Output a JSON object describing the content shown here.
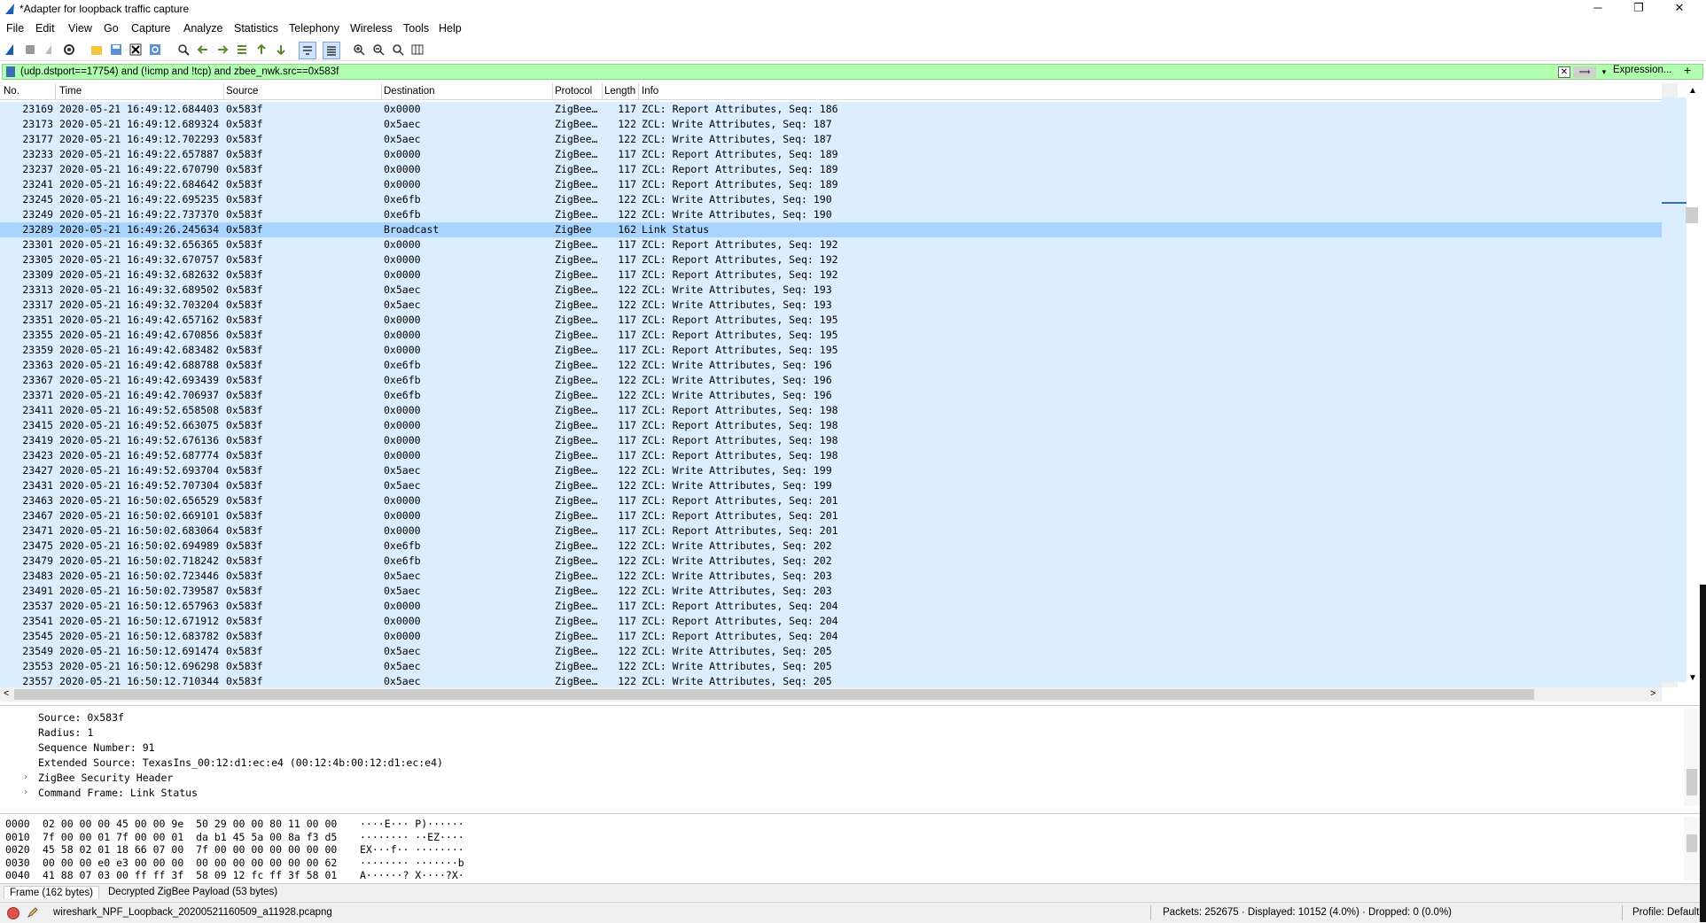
{
  "window": {
    "title": "*Adapter for loopback traffic capture",
    "minimize": "─",
    "restore": "❐",
    "close": "✕"
  },
  "menu": [
    "File",
    "Edit",
    "View",
    "Go",
    "Capture",
    "Analyze",
    "Statistics",
    "Telephony",
    "Wireless",
    "Tools",
    "Help"
  ],
  "filter": {
    "value": "(udp.dstport==17754) and (!icmp and !tcp) and zbee_nwk.src==0x583f",
    "clear": "✕",
    "apply": "⟹",
    "dropdown": "▾",
    "expression_label": "Expression...",
    "add_label": "+"
  },
  "columns": {
    "no": "No.",
    "time": "Time",
    "source": "Source",
    "destination": "Destination",
    "protocol": "Protocol",
    "length": "Length",
    "info": "Info"
  },
  "packets": [
    {
      "no": "23169",
      "time": "2020-05-21 16:49:12.684403",
      "src": "0x583f",
      "dst": "0x0000",
      "proto": "ZigBee…",
      "len": "117",
      "info": "ZCL: Report Attributes, Seq: 186",
      "selected": false
    },
    {
      "no": "23173",
      "time": "2020-05-21 16:49:12.689324",
      "src": "0x583f",
      "dst": "0x5aec",
      "proto": "ZigBee…",
      "len": "122",
      "info": "ZCL: Write Attributes, Seq: 187",
      "selected": false
    },
    {
      "no": "23177",
      "time": "2020-05-21 16:49:12.702293",
      "src": "0x583f",
      "dst": "0x5aec",
      "proto": "ZigBee…",
      "len": "122",
      "info": "ZCL: Write Attributes, Seq: 187",
      "selected": false
    },
    {
      "no": "23233",
      "time": "2020-05-21 16:49:22.657887",
      "src": "0x583f",
      "dst": "0x0000",
      "proto": "ZigBee…",
      "len": "117",
      "info": "ZCL: Report Attributes, Seq: 189",
      "selected": false
    },
    {
      "no": "23237",
      "time": "2020-05-21 16:49:22.670790",
      "src": "0x583f",
      "dst": "0x0000",
      "proto": "ZigBee…",
      "len": "117",
      "info": "ZCL: Report Attributes, Seq: 189",
      "selected": false
    },
    {
      "no": "23241",
      "time": "2020-05-21 16:49:22.684642",
      "src": "0x583f",
      "dst": "0x0000",
      "proto": "ZigBee…",
      "len": "117",
      "info": "ZCL: Report Attributes, Seq: 189",
      "selected": false
    },
    {
      "no": "23245",
      "time": "2020-05-21 16:49:22.695235",
      "src": "0x583f",
      "dst": "0xe6fb",
      "proto": "ZigBee…",
      "len": "122",
      "info": "ZCL: Write Attributes, Seq: 190",
      "selected": false
    },
    {
      "no": "23249",
      "time": "2020-05-21 16:49:22.737370",
      "src": "0x583f",
      "dst": "0xe6fb",
      "proto": "ZigBee…",
      "len": "122",
      "info": "ZCL: Write Attributes, Seq: 190",
      "selected": false
    },
    {
      "no": "23289",
      "time": "2020-05-21 16:49:26.245634",
      "src": "0x583f",
      "dst": "Broadcast",
      "proto": "ZigBee",
      "len": "162",
      "info": "Link Status",
      "selected": true
    },
    {
      "no": "23301",
      "time": "2020-05-21 16:49:32.656365",
      "src": "0x583f",
      "dst": "0x0000",
      "proto": "ZigBee…",
      "len": "117",
      "info": "ZCL: Report Attributes, Seq: 192",
      "selected": false
    },
    {
      "no": "23305",
      "time": "2020-05-21 16:49:32.670757",
      "src": "0x583f",
      "dst": "0x0000",
      "proto": "ZigBee…",
      "len": "117",
      "info": "ZCL: Report Attributes, Seq: 192",
      "selected": false
    },
    {
      "no": "23309",
      "time": "2020-05-21 16:49:32.682632",
      "src": "0x583f",
      "dst": "0x0000",
      "proto": "ZigBee…",
      "len": "117",
      "info": "ZCL: Report Attributes, Seq: 192",
      "selected": false
    },
    {
      "no": "23313",
      "time": "2020-05-21 16:49:32.689502",
      "src": "0x583f",
      "dst": "0x5aec",
      "proto": "ZigBee…",
      "len": "122",
      "info": "ZCL: Write Attributes, Seq: 193",
      "selected": false
    },
    {
      "no": "23317",
      "time": "2020-05-21 16:49:32.703204",
      "src": "0x583f",
      "dst": "0x5aec",
      "proto": "ZigBee…",
      "len": "122",
      "info": "ZCL: Write Attributes, Seq: 193",
      "selected": false
    },
    {
      "no": "23351",
      "time": "2020-05-21 16:49:42.657162",
      "src": "0x583f",
      "dst": "0x0000",
      "proto": "ZigBee…",
      "len": "117",
      "info": "ZCL: Report Attributes, Seq: 195",
      "selected": false
    },
    {
      "no": "23355",
      "time": "2020-05-21 16:49:42.670856",
      "src": "0x583f",
      "dst": "0x0000",
      "proto": "ZigBee…",
      "len": "117",
      "info": "ZCL: Report Attributes, Seq: 195",
      "selected": false
    },
    {
      "no": "23359",
      "time": "2020-05-21 16:49:42.683482",
      "src": "0x583f",
      "dst": "0x0000",
      "proto": "ZigBee…",
      "len": "117",
      "info": "ZCL: Report Attributes, Seq: 195",
      "selected": false
    },
    {
      "no": "23363",
      "time": "2020-05-21 16:49:42.688788",
      "src": "0x583f",
      "dst": "0xe6fb",
      "proto": "ZigBee…",
      "len": "122",
      "info": "ZCL: Write Attributes, Seq: 196",
      "selected": false
    },
    {
      "no": "23367",
      "time": "2020-05-21 16:49:42.693439",
      "src": "0x583f",
      "dst": "0xe6fb",
      "proto": "ZigBee…",
      "len": "122",
      "info": "ZCL: Write Attributes, Seq: 196",
      "selected": false
    },
    {
      "no": "23371",
      "time": "2020-05-21 16:49:42.706937",
      "src": "0x583f",
      "dst": "0xe6fb",
      "proto": "ZigBee…",
      "len": "122",
      "info": "ZCL: Write Attributes, Seq: 196",
      "selected": false
    },
    {
      "no": "23411",
      "time": "2020-05-21 16:49:52.658508",
      "src": "0x583f",
      "dst": "0x0000",
      "proto": "ZigBee…",
      "len": "117",
      "info": "ZCL: Report Attributes, Seq: 198",
      "selected": false
    },
    {
      "no": "23415",
      "time": "2020-05-21 16:49:52.663075",
      "src": "0x583f",
      "dst": "0x0000",
      "proto": "ZigBee…",
      "len": "117",
      "info": "ZCL: Report Attributes, Seq: 198",
      "selected": false
    },
    {
      "no": "23419",
      "time": "2020-05-21 16:49:52.676136",
      "src": "0x583f",
      "dst": "0x0000",
      "proto": "ZigBee…",
      "len": "117",
      "info": "ZCL: Report Attributes, Seq: 198",
      "selected": false
    },
    {
      "no": "23423",
      "time": "2020-05-21 16:49:52.687774",
      "src": "0x583f",
      "dst": "0x0000",
      "proto": "ZigBee…",
      "len": "117",
      "info": "ZCL: Report Attributes, Seq: 198",
      "selected": false
    },
    {
      "no": "23427",
      "time": "2020-05-21 16:49:52.693704",
      "src": "0x583f",
      "dst": "0x5aec",
      "proto": "ZigBee…",
      "len": "122",
      "info": "ZCL: Write Attributes, Seq: 199",
      "selected": false
    },
    {
      "no": "23431",
      "time": "2020-05-21 16:49:52.707304",
      "src": "0x583f",
      "dst": "0x5aec",
      "proto": "ZigBee…",
      "len": "122",
      "info": "ZCL: Write Attributes, Seq: 199",
      "selected": false
    },
    {
      "no": "23463",
      "time": "2020-05-21 16:50:02.656529",
      "src": "0x583f",
      "dst": "0x0000",
      "proto": "ZigBee…",
      "len": "117",
      "info": "ZCL: Report Attributes, Seq: 201",
      "selected": false
    },
    {
      "no": "23467",
      "time": "2020-05-21 16:50:02.669101",
      "src": "0x583f",
      "dst": "0x0000",
      "proto": "ZigBee…",
      "len": "117",
      "info": "ZCL: Report Attributes, Seq: 201",
      "selected": false
    },
    {
      "no": "23471",
      "time": "2020-05-21 16:50:02.683064",
      "src": "0x583f",
      "dst": "0x0000",
      "proto": "ZigBee…",
      "len": "117",
      "info": "ZCL: Report Attributes, Seq: 201",
      "selected": false
    },
    {
      "no": "23475",
      "time": "2020-05-21 16:50:02.694989",
      "src": "0x583f",
      "dst": "0xe6fb",
      "proto": "ZigBee…",
      "len": "122",
      "info": "ZCL: Write Attributes, Seq: 202",
      "selected": false
    },
    {
      "no": "23479",
      "time": "2020-05-21 16:50:02.718242",
      "src": "0x583f",
      "dst": "0xe6fb",
      "proto": "ZigBee…",
      "len": "122",
      "info": "ZCL: Write Attributes, Seq: 202",
      "selected": false
    },
    {
      "no": "23483",
      "time": "2020-05-21 16:50:02.723446",
      "src": "0x583f",
      "dst": "0x5aec",
      "proto": "ZigBee…",
      "len": "122",
      "info": "ZCL: Write Attributes, Seq: 203",
      "selected": false
    },
    {
      "no": "23491",
      "time": "2020-05-21 16:50:02.739587",
      "src": "0x583f",
      "dst": "0x5aec",
      "proto": "ZigBee…",
      "len": "122",
      "info": "ZCL: Write Attributes, Seq: 203",
      "selected": false
    },
    {
      "no": "23537",
      "time": "2020-05-21 16:50:12.657963",
      "src": "0x583f",
      "dst": "0x0000",
      "proto": "ZigBee…",
      "len": "117",
      "info": "ZCL: Report Attributes, Seq: 204",
      "selected": false
    },
    {
      "no": "23541",
      "time": "2020-05-21 16:50:12.671912",
      "src": "0x583f",
      "dst": "0x0000",
      "proto": "ZigBee…",
      "len": "117",
      "info": "ZCL: Report Attributes, Seq: 204",
      "selected": false
    },
    {
      "no": "23545",
      "time": "2020-05-21 16:50:12.683782",
      "src": "0x583f",
      "dst": "0x0000",
      "proto": "ZigBee…",
      "len": "117",
      "info": "ZCL: Report Attributes, Seq: 204",
      "selected": false
    },
    {
      "no": "23549",
      "time": "2020-05-21 16:50:12.691474",
      "src": "0x583f",
      "dst": "0x5aec",
      "proto": "ZigBee…",
      "len": "122",
      "info": "ZCL: Write Attributes, Seq: 205",
      "selected": false
    },
    {
      "no": "23553",
      "time": "2020-05-21 16:50:12.696298",
      "src": "0x583f",
      "dst": "0x5aec",
      "proto": "ZigBee…",
      "len": "122",
      "info": "ZCL: Write Attributes, Seq: 205",
      "selected": false
    },
    {
      "no": "23557",
      "time": "2020-05-21 16:50:12.710344",
      "src": "0x583f",
      "dst": "0x5aec",
      "proto": "ZigBee…",
      "len": "122",
      "info": "ZCL: Write Attributes, Seq: 205",
      "selected": false
    }
  ],
  "details": [
    {
      "text": "Source: 0x583f",
      "expandable": false
    },
    {
      "text": "Radius: 1",
      "expandable": false
    },
    {
      "text": "Sequence Number: 91",
      "expandable": false
    },
    {
      "text": "Extended Source: TexasIns_00:12:d1:ec:e4 (00:12:4b:00:12:d1:ec:e4)",
      "expandable": false
    },
    {
      "text": "ZigBee Security Header",
      "expandable": true
    },
    {
      "text": "Command Frame: Link Status",
      "expandable": true
    }
  ],
  "bytes": [
    {
      "offset": "0000",
      "hex": "02 00 00 00 45 00 00 9e  50 29 00 00 80 11 00 00",
      "ascii": "····E··· P)······"
    },
    {
      "offset": "0010",
      "hex": "7f 00 00 01 7f 00 00 01  da b1 45 5a 00 8a f3 d5",
      "ascii": "········ ··EZ····"
    },
    {
      "offset": "0020",
      "hex": "45 58 02 01 18 66 07 00  7f 00 00 00 00 00 00 00",
      "ascii": "EX···f·· ········"
    },
    {
      "offset": "0030",
      "hex": "00 00 00 e0 e3 00 00 00  00 00 00 00 00 00 00 62",
      "ascii": "········ ·······b"
    },
    {
      "offset": "0040",
      "hex": "41 88 07 03 00 ff ff 3f  58 09 12 fc ff 3f 58 01",
      "ascii": "A······? X····?X·"
    }
  ],
  "byte_tabs": [
    "Frame (162 bytes)",
    "Decrypted ZigBee Payload (53 bytes)"
  ],
  "status": {
    "file": "wireshark_NPF_Loopback_20200521160509_a11928.pcapng",
    "packets": "Packets: 252675 · Displayed: 10152 (4.0%) · Dropped: 0 (0.0%)",
    "profile": "Profile: Default"
  },
  "colors": {
    "row_bg": "#daeeff",
    "row_selected": "#a8d4ff",
    "filter_bg": "#afffaf"
  },
  "icons": {
    "app": "shark-fin-icon",
    "toolbar": [
      "start-capture-icon",
      "stop-capture-icon",
      "restart-capture-icon",
      "capture-options-icon",
      "open-file-icon",
      "save-file-icon",
      "close-file-icon",
      "reload-file-icon",
      "find-packet-icon",
      "go-back-icon",
      "go-forward-icon",
      "go-to-packet-icon",
      "first-packet-icon",
      "last-packet-icon",
      "auto-scroll-icon",
      "colorize-icon",
      "zoom-in-icon",
      "zoom-out-icon",
      "zoom-normal-icon",
      "resize-columns-icon"
    ]
  }
}
